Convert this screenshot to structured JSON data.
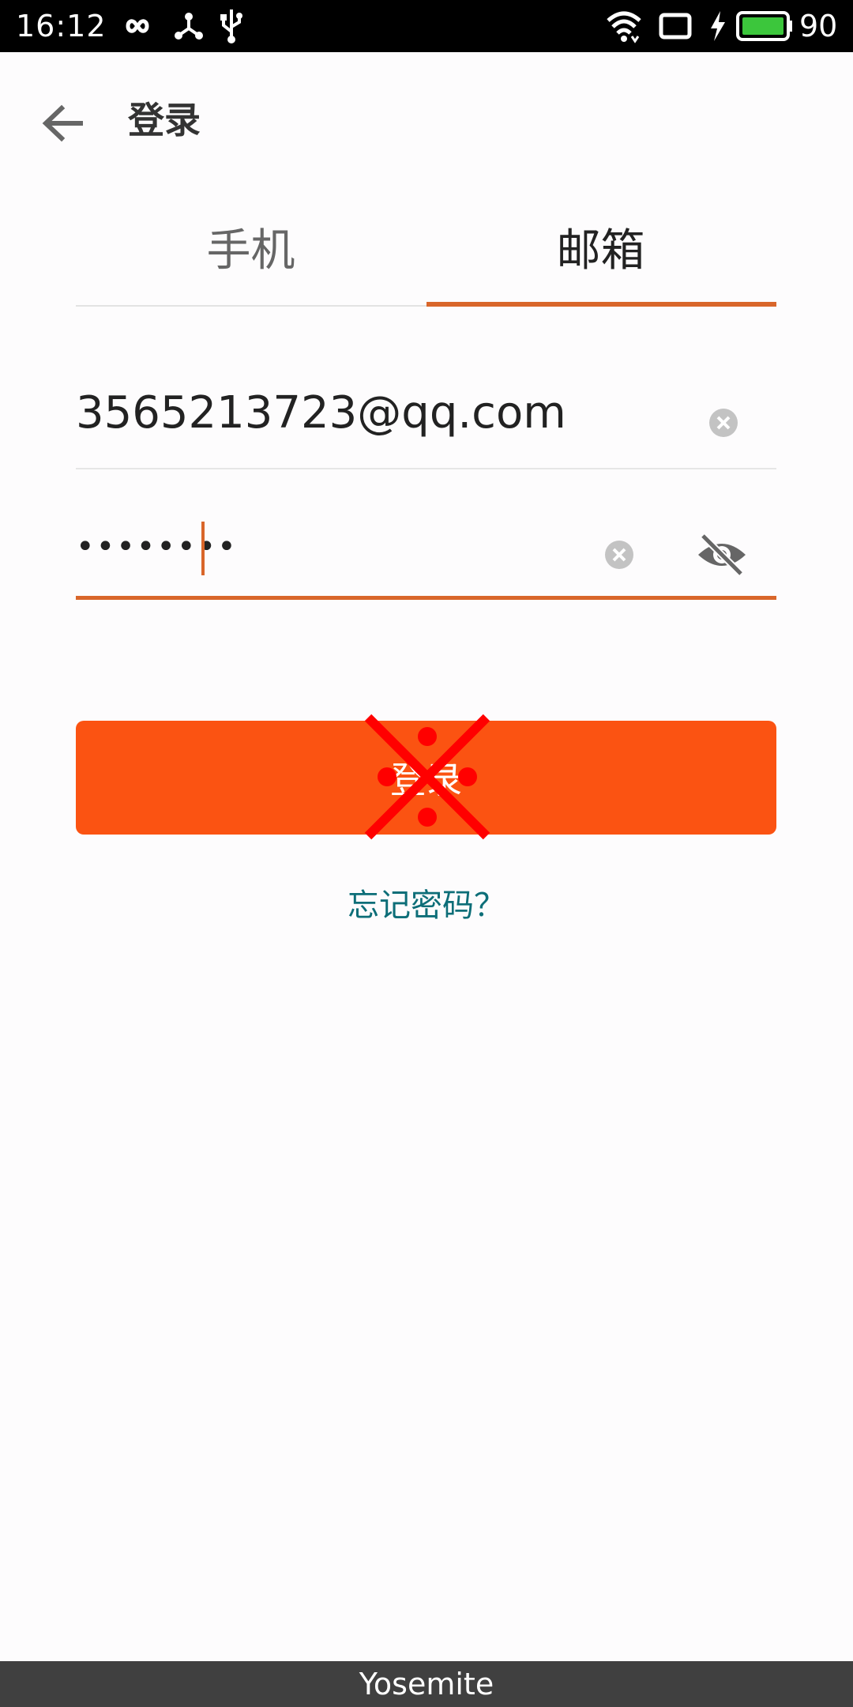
{
  "status_bar": {
    "time": "16:12",
    "battery_level": "90",
    "icons": [
      "infinity-icon",
      "share-icon",
      "usb-icon",
      "wifi-icon",
      "screen-rotation-icon",
      "charging-bolt-icon",
      "battery-icon"
    ]
  },
  "app_bar": {
    "title": "登录"
  },
  "tabs": [
    {
      "label": "手机",
      "active": false
    },
    {
      "label": "邮箱",
      "active": true
    }
  ],
  "email_field": {
    "value": "3565213723@qq.com"
  },
  "password_field": {
    "masked_value": "••••••••"
  },
  "login_button": {
    "label": "登录"
  },
  "forgot_password": {
    "label": "忘记密码？"
  },
  "bottom_bar": {
    "label": "Yosemite"
  },
  "colors": {
    "accent": "#d9662a",
    "button": "#fb5312",
    "link": "#0d6e78",
    "tap_marker": "#ff0000"
  }
}
